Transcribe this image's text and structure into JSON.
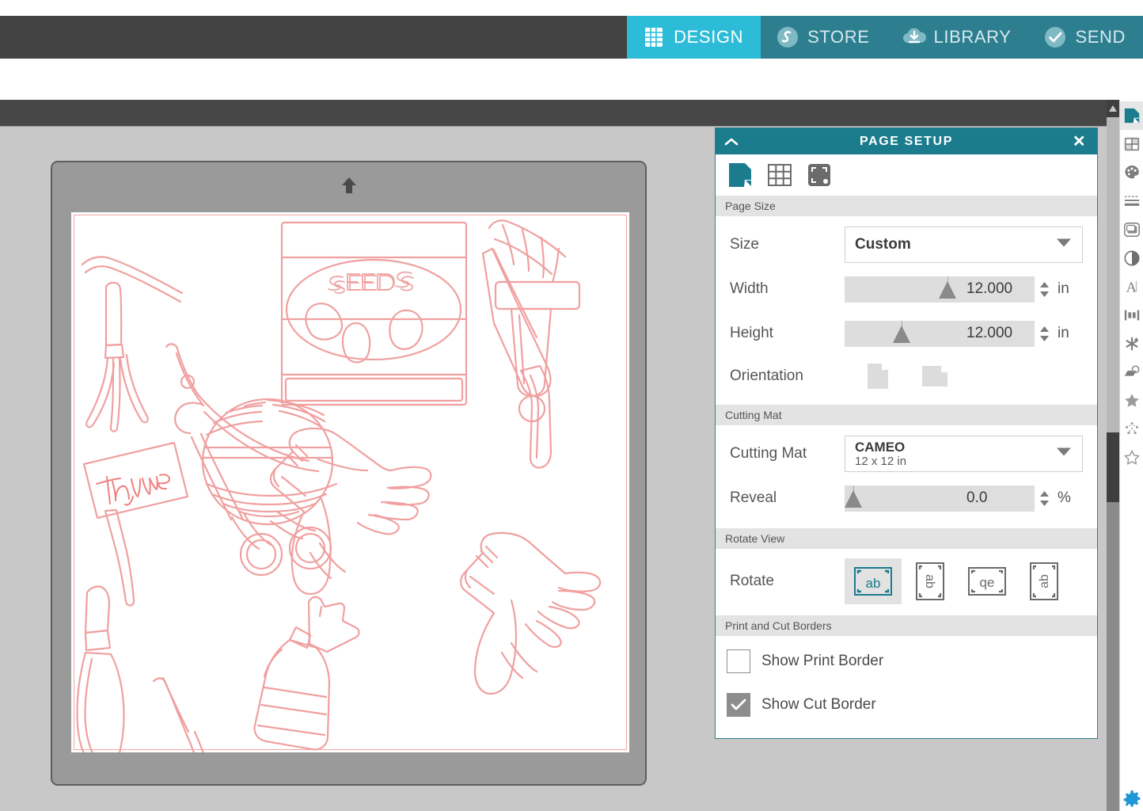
{
  "nav": {
    "tabs": [
      {
        "label": "DESIGN",
        "icon": "grid-icon",
        "active": true
      },
      {
        "label": "STORE",
        "icon": "store-icon",
        "active": false
      },
      {
        "label": "LIBRARY",
        "icon": "cloud-download-icon",
        "active": false
      },
      {
        "label": "SEND",
        "icon": "check-circle-icon",
        "active": false
      }
    ]
  },
  "canvas": {
    "mat_arrow_icon": "up-arrow-icon",
    "artwork_texts": {
      "seed_packet": "SEEDS",
      "plant_marker": "Thyme"
    },
    "cut_color": "#f3a3a3"
  },
  "panel": {
    "title": "PAGE SETUP",
    "collapse_icon": "chevron-up-icon",
    "close_icon": "close-icon",
    "tabs": [
      {
        "name": "page-tab",
        "icon": "page-icon",
        "active": true
      },
      {
        "name": "grid-tab",
        "icon": "grid-icon",
        "active": false
      },
      {
        "name": "reg-mark-tab",
        "icon": "reg-marks-icon",
        "active": false
      }
    ],
    "sections": {
      "page_size": {
        "header": "Page Size",
        "size_label": "Size",
        "size_value": "Custom",
        "width_label": "Width",
        "width_value": "12.000",
        "width_unit": "in",
        "height_label": "Height",
        "height_value": "12.000",
        "height_unit": "in",
        "orientation_label": "Orientation",
        "orientation_options": [
          "portrait-icon",
          "landscape-icon"
        ]
      },
      "cutting_mat": {
        "header": "Cutting Mat",
        "mat_label": "Cutting Mat",
        "mat_value": "CAMEO",
        "mat_sub": "12 x 12 in",
        "reveal_label": "Reveal",
        "reveal_value": "0.0",
        "reveal_unit": "%"
      },
      "rotate_view": {
        "header": "Rotate View",
        "rotate_label": "Rotate",
        "options": [
          {
            "glyph": "ab",
            "rotation": 0,
            "active": true
          },
          {
            "glyph": "ab",
            "rotation": 90,
            "active": false
          },
          {
            "glyph": "qe",
            "rotation": 180,
            "active": false
          },
          {
            "glyph": "ab",
            "rotation": 270,
            "active": false
          }
        ]
      },
      "borders": {
        "header": "Print and Cut Borders",
        "print_border_label": "Show Print Border",
        "print_border_checked": false,
        "cut_border_label": "Show Cut Border",
        "cut_border_checked": true
      }
    }
  },
  "rail": {
    "items": [
      {
        "name": "page-setup",
        "icon": "page-icon",
        "active": true
      },
      {
        "name": "quick-access",
        "icon": "panels-icon",
        "active": false
      },
      {
        "name": "fill-color",
        "icon": "palette-icon",
        "active": false
      },
      {
        "name": "line-style",
        "icon": "line-style-icon",
        "active": false
      },
      {
        "name": "shadow",
        "icon": "shadow-icon",
        "active": false
      },
      {
        "name": "transparency",
        "icon": "contrast-icon",
        "active": false
      },
      {
        "name": "text-style",
        "icon": "text-icon",
        "active": false
      },
      {
        "name": "align",
        "icon": "align-icon",
        "active": false
      },
      {
        "name": "modify",
        "icon": "sparkle-icon",
        "active": false
      },
      {
        "name": "offset",
        "icon": "offset-icon",
        "active": false
      },
      {
        "name": "trace",
        "icon": "star-filled-icon",
        "active": false
      },
      {
        "name": "sketch",
        "icon": "star-dots-icon",
        "active": false
      },
      {
        "name": "library-star",
        "icon": "star-outline-icon",
        "active": false
      }
    ],
    "settings_icon": "gear-icon"
  },
  "scrollbar": {
    "up_arrow_icon": "scroll-up-icon"
  },
  "colors": {
    "nav_active": "#2cbcd8",
    "nav_inactive": "#2d7f8f",
    "panel_header": "#1b7c8d",
    "chrome_dark": "#434343",
    "workspace": "#c8c8c8",
    "mat": "#9a9a9a",
    "cut_line": "#f3a3a3"
  }
}
